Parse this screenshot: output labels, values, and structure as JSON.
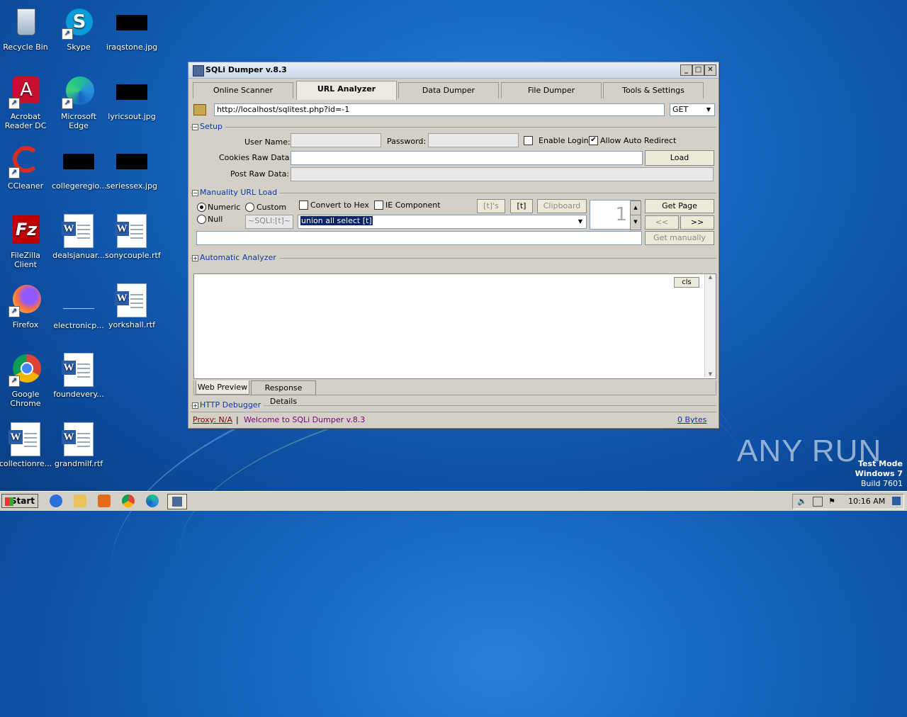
{
  "desktop": {
    "icons": [
      {
        "label": "Recycle Bin"
      },
      {
        "label": "Skype"
      },
      {
        "label": "iraqstone.jpg"
      },
      {
        "label": "Acrobat Reader DC"
      },
      {
        "label": "Microsoft Edge"
      },
      {
        "label": "lyricsout.jpg"
      },
      {
        "label": "CCleaner"
      },
      {
        "label": "collegeregio..."
      },
      {
        "label": "seriessex.jpg"
      },
      {
        "label": "FileZilla Client"
      },
      {
        "label": "dealsjanuar..."
      },
      {
        "label": "sonycouple.rtf"
      },
      {
        "label": "Firefox"
      },
      {
        "label": "electronicp..."
      },
      {
        "label": "yorkshall.rtf"
      },
      {
        "label": "Google Chrome"
      },
      {
        "label": "foundevery..."
      },
      {
        "label": "collectionre..."
      },
      {
        "label": "grandmilf.rtf"
      }
    ]
  },
  "window": {
    "title": "SQLi Dumper v.8.3",
    "controls": {
      "minimize": "_",
      "maximize": "□",
      "close": "✕"
    },
    "tabs": [
      {
        "label": "Online Scanner"
      },
      {
        "label": "URL Analyzer"
      },
      {
        "label": "Data Dumper"
      },
      {
        "label": "File Dumper"
      },
      {
        "label": "Tools & Settings"
      }
    ],
    "active_tab": "URL Analyzer",
    "url": "http://localhost/sqlitest.php?id=-1",
    "method": "GET",
    "setup": {
      "title": "Setup",
      "username_label": "User Name:",
      "password_label": "Password:",
      "enable_login_label": "Enable Login",
      "enable_login_checked": false,
      "auto_redirect_label": "Allow Auto Redirect",
      "auto_redirect_checked": true,
      "cookies_label": "Cookies Raw Data:",
      "post_label": "Post Raw Data:",
      "load_button": "Load"
    },
    "manual": {
      "title": "Manuality URL Load",
      "numeric_label": "Numeric",
      "null_label": "Null",
      "custom_label": "Custom",
      "custom_value": "~SQLI:[t]~",
      "convert_hex_label": "Convert to Hex",
      "ie_component_label": "IE Component",
      "btn_ts": "[t]'s",
      "btn_t": "[t]",
      "btn_clipboard": "Clipboard",
      "spinner_value": "1",
      "get_page": "Get Page",
      "prev": "<<",
      "next": ">>",
      "get_manually": "Get manually",
      "union_value": "union all select [t]"
    },
    "auto_analyzer": "Automatic Analyzer",
    "cls_button": "cls",
    "sub_tabs": [
      {
        "label": "Web Preview"
      },
      {
        "label": "Response Details"
      }
    ],
    "http_debugger": "HTTP Debugger",
    "status": {
      "proxy": "Proxy: N/A",
      "separator": "|",
      "welcome": "Welcome to SQLi Dumper v.8.3",
      "bytes": "0 Bytes"
    }
  },
  "taskbar": {
    "start": "Start",
    "time": "10:16 AM"
  },
  "watermark": {
    "text": "ANY RUN"
  },
  "test_mode": {
    "line1": "Test Mode",
    "line2": "Windows 7",
    "line3": "Build 7601"
  },
  "colors": {
    "accent": "#0b3aa8",
    "status_link": "#8b0000",
    "status_welcome": "#800080",
    "selection": "#0a246a"
  }
}
